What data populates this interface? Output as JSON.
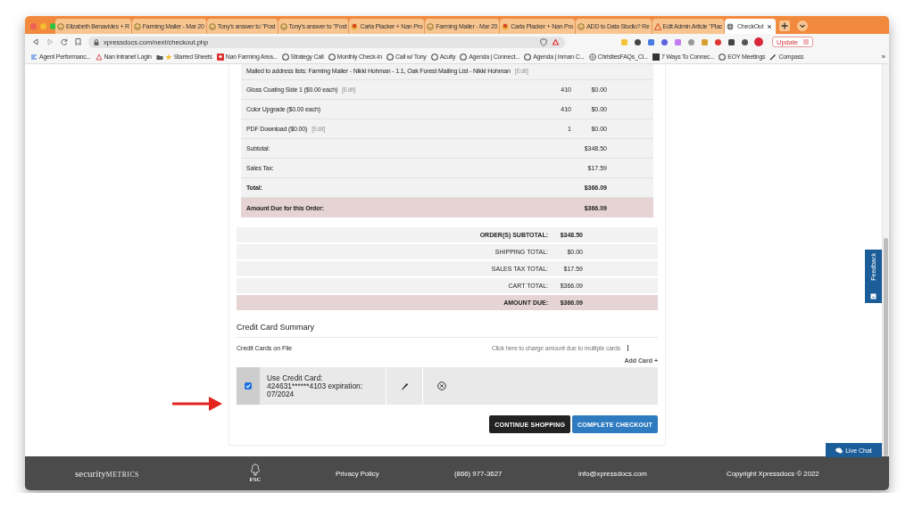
{
  "browser": {
    "tabs": [
      {
        "title": "Elizabeth Benavides + R",
        "selected": false
      },
      {
        "title": "Farming Mailer - Mar 20",
        "selected": false
      },
      {
        "title": "Tony's answer to \"Post",
        "selected": false
      },
      {
        "title": "Tony's answer to \"Post",
        "selected": false
      },
      {
        "title": "Carla Placker + Nan Pro",
        "selected": false
      },
      {
        "title": "Farming Mailer - Mar 20",
        "selected": false
      },
      {
        "title": "Carla Placker + Nan Pro",
        "selected": false
      },
      {
        "title": "ADD to Data Studio? Re",
        "selected": false
      },
      {
        "title": "Edit Admin Article \"Plac",
        "selected": false
      },
      {
        "title": "CheckOut",
        "selected": true
      }
    ],
    "url": "xpressdocs.com/next/checkout.php",
    "update_button": "Update",
    "bookmarks": [
      "Agent Performanc...",
      "Nan Intranet Login",
      "Starred Sheets",
      "Nan Farming Area...",
      "Strategy Call",
      "Monthly Check-In",
      "Call w/ Tony",
      "Acuity",
      "Agenda | Connect...",
      "Agenda | Inman C...",
      "ChristiesFAQs_Cl...",
      "7 Ways To Connec...",
      "EOY Meetings",
      "Compass"
    ],
    "bookmarks_more": "»"
  },
  "order_lines": [
    {
      "kind": "item",
      "label": "Mailed to address lists: Farming Mailer - Nikki Hohman - 1.1, Oak Forest Mailing List - Nikki Hohman",
      "edit": "[Edit]"
    },
    {
      "kind": "item",
      "label": "Gloss Coating Side 1 ($0.00 each)",
      "edit": "[Edit]",
      "qty": "410",
      "price": "$0.00"
    },
    {
      "kind": "item",
      "label": "Color Upgrade ($0.00 each)",
      "qty": "410",
      "price": "$0.00"
    },
    {
      "kind": "item",
      "label": "PDF Download ($0.00)",
      "edit": "[Edit]",
      "qty": "1",
      "price": "$0.00"
    },
    {
      "kind": "item",
      "label": "Subtotal:",
      "price": "$348.50"
    },
    {
      "kind": "item",
      "label": "Sales Tax:",
      "price": "$17.59"
    },
    {
      "kind": "total",
      "label": "Total:",
      "price": "$366.09"
    },
    {
      "kind": "due",
      "label": "Amount Due for this Order:",
      "price": "$366.09"
    }
  ],
  "cart_totals": [
    {
      "kind": "total",
      "label": "ORDER(S) SUBTOTAL:",
      "value": "$348.50"
    },
    {
      "kind": "item",
      "label": "SHIPPING TOTAL:",
      "value": "$0.00"
    },
    {
      "kind": "item",
      "label": "SALES TAX TOTAL:",
      "value": "$17.59"
    },
    {
      "kind": "item",
      "label": "CART TOTAL:",
      "value": "$366.09"
    },
    {
      "kind": "due",
      "label": "AMOUNT DUE:",
      "value": "$366.09"
    }
  ],
  "credit_cards": {
    "heading": "Credit Card Summary",
    "on_file_label": "Credit Cards on File",
    "multiple_cards_link": "Click here to charge amount due to multiple cards",
    "add_card": "Add Card +",
    "cards": [
      {
        "text": "Use Credit Card: 424631******4103 expiration: 07/2024",
        "checked": true
      }
    ]
  },
  "buttons": [
    {
      "label": "CONTINUE SHOPPING",
      "kind": "dark"
    },
    {
      "label": "COMPLETE CHECKOUT",
      "kind": "primary"
    }
  ],
  "feedback_tab": "Feedback",
  "live_chat": "Live Chat",
  "footer": {
    "logo_part_1": "security",
    "logo_part_2": "METRICS",
    "fsc": "FSC",
    "links": [
      "Privacy Policy",
      "(866) 977-3627",
      "info@xpressdocs.com"
    ],
    "copyright": "Copyright Xpressdocs © 2022"
  }
}
